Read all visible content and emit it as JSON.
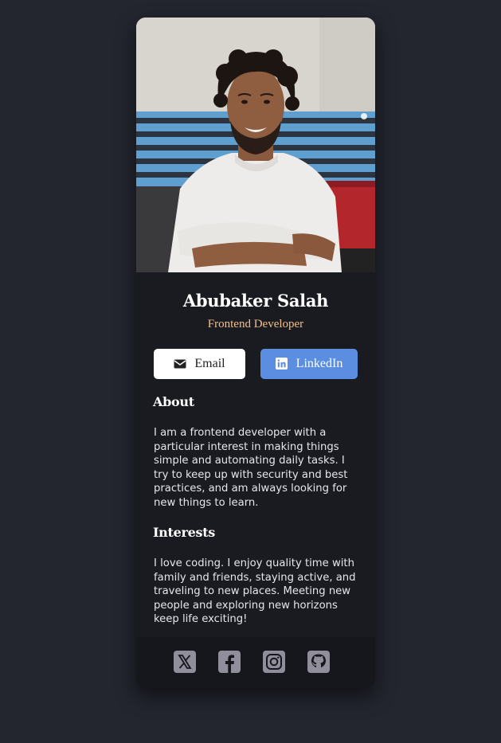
{
  "profile": {
    "photo_alt": "profile-photo",
    "name": "Abubaker Salah",
    "role": "Frontend Developer"
  },
  "buttons": {
    "email_label": "Email",
    "email_icon": "envelope-icon",
    "linkedin_label": "LinkedIn",
    "linkedin_icon": "linkedin-icon"
  },
  "about": {
    "heading": "About",
    "text": "I am a frontend developer with a particular interest in making things simple and automating daily tasks. I try to keep up with security and best practices, and am always looking for new things to learn."
  },
  "interests": {
    "heading": "Interests",
    "text": "I love coding. I enjoy quality time with family and friends, staying active, and traveling to new places. Meeting new people and exploring new horizons keep life exciting!"
  },
  "social": {
    "icons": [
      "x-icon",
      "facebook-icon",
      "instagram-icon",
      "github-icon"
    ]
  },
  "colors": {
    "background": "#23252f",
    "card": "#1a1b21",
    "footer": "#16171c",
    "role_accent": "#f3bf8a",
    "linkedin_button": "#5b8ee0",
    "social_icon": "#918e9b"
  }
}
